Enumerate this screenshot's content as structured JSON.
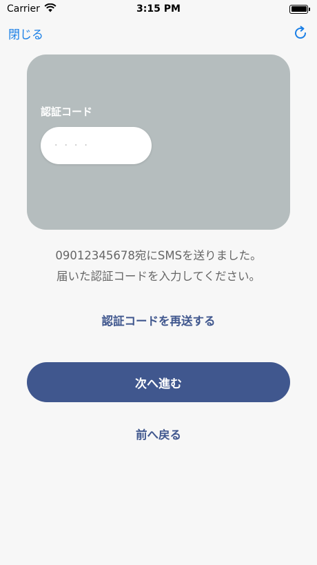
{
  "status_bar": {
    "carrier": "Carrier",
    "time": "3:15 PM",
    "icons": [
      "wifi-icon",
      "battery-icon"
    ]
  },
  "nav": {
    "close_label": "閉じる",
    "reload_icon": "reload-icon"
  },
  "card": {
    "background_color": "#b5bdbe",
    "code_label": "認証コード",
    "code_input": {
      "value": "",
      "placeholder": "····"
    }
  },
  "message": {
    "line1": "09012345678宛にSMSを送りました。",
    "line2": "届いた認証コードを入力してください。"
  },
  "actions": {
    "resend_label": "認証コードを再送する",
    "next_label": "次へ進む",
    "back_label": "前へ戻る"
  },
  "colors": {
    "accent_blue": "#1a7fe6",
    "primary": "#40578e",
    "background": "#f7f7f7"
  }
}
